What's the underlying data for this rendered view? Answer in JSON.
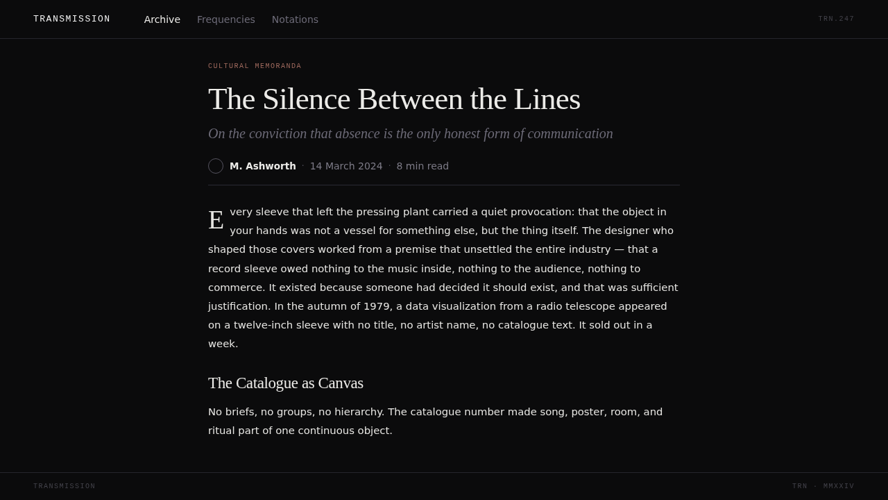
{
  "header": {
    "brand": "TRANSMISSION",
    "nav": [
      {
        "label": "Archive",
        "selected": true
      },
      {
        "label": "Frequencies",
        "selected": false
      },
      {
        "label": "Notations",
        "selected": false
      }
    ],
    "code": "TRN.247"
  },
  "article": {
    "category": "CULTURAL MEMORANDA",
    "title": "The Silence Between the Lines",
    "subtitle": "On the conviction that absence is the only honest form of communication",
    "meta": {
      "author": "M. Ashworth",
      "separator_1": "·",
      "date": "14 March 2024",
      "separator_2": "·",
      "read_time": "8 min read"
    },
    "drop_cap": "E",
    "lead": "very sleeve that left the pressing plant carried a quiet provocation: that the object in your hands was not a vessel for something else, but the thing itself. The designer who shaped those covers worked from a premise that unsettled the entire industry — that a record sleeve owed nothing to the music inside, nothing to the audience, nothing to commerce. It existed because someone had decided it should exist, and that was sufficient justification. In the autumn of 1979, a data visualization from a radio telescope appeared on a twelve-inch sleeve with no title, no artist name, no catalogue text. It sold out in a week.",
    "section_heading": "The Catalogue as Canvas",
    "section_text": "No briefs, no groups, no hierarchy. The catalogue number made song, poster, room, and ritual part of one continuous object."
  },
  "footer": {
    "brand": "TRANSMISSION",
    "code": "TRN · MMXXIV"
  }
}
